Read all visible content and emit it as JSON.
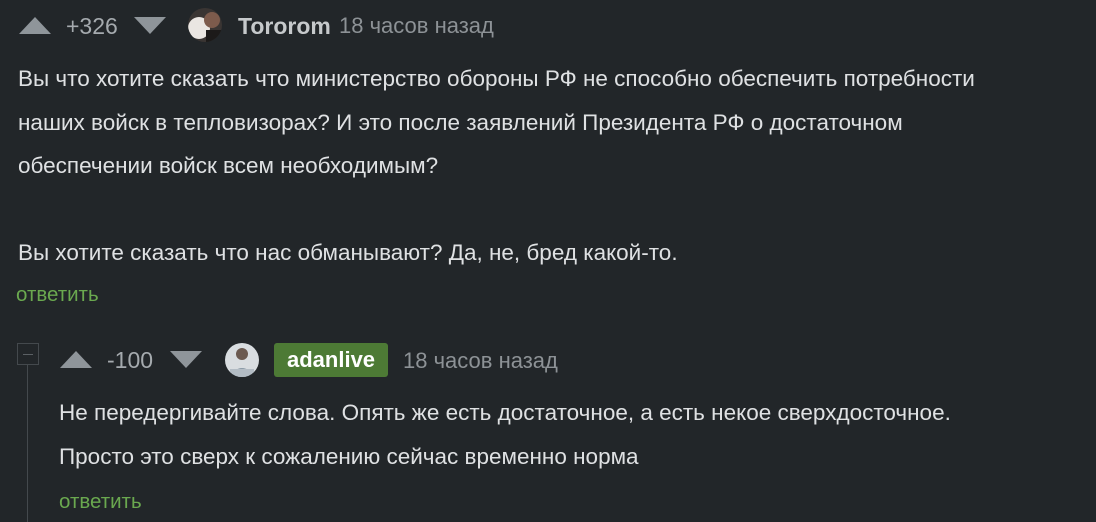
{
  "comments": [
    {
      "rating": "+326",
      "username": "Tororom",
      "time": "18 часов назад",
      "lines": [
        "Вы что хотите сказать что министерство обороны РФ не способно обеспечить потребности",
        "наших войск в тепловизорах? И это после заявлений Президента РФ о достаточном",
        "обеспечении войск всем необходимым?",
        "",
        "Вы хотите сказать что нас обманывают? Да, не, бред какой-то."
      ],
      "reply_label": "ответить"
    },
    {
      "rating": "-100",
      "username": "adanlive",
      "time": "18 часов назад",
      "lines": [
        "Не передергивайте слова. Опять же есть достаточное, а есть некое сверхдосточное.",
        "Просто это сверх к сожалению сейчас временно норма"
      ],
      "reply_label": "ответить"
    }
  ],
  "colors": {
    "background": "#222629",
    "vote_arrow": "#8f959a",
    "reply_link": "#6aa84f",
    "badge": "#4d7a35"
  }
}
